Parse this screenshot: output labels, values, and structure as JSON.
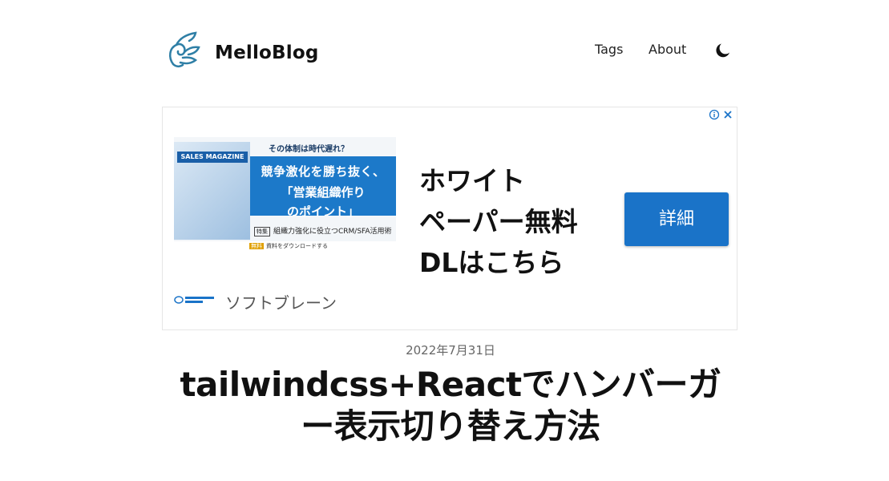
{
  "header": {
    "site_title": "MelloBlog",
    "nav": [
      {
        "label": "Tags"
      },
      {
        "label": "About"
      }
    ],
    "logo_icon": "wing-icon",
    "theme_toggle_icon": "moon-icon",
    "logo_color": "#2f7fa6"
  },
  "ad": {
    "info_icon": "info-icon",
    "close_icon": "close-icon",
    "image": {
      "magazine_title": "SALES MAGAZINE",
      "top_text": "その体制は時代遅れ？",
      "line1": "競争激化を勝ち抜く、",
      "line2": "「営業組織作り",
      "line3": "のポイント」",
      "bottom_tag": "特集",
      "bottom_text": "組織力強化に役立つCRM/SFA活用術",
      "download_tag": "無料",
      "download_text": "資料をダウンロードする"
    },
    "headline": "ホワイト\nペーパー無料\nDLはこちら",
    "cta_label": "詳細",
    "advertiser": "ソフトブレーン",
    "cta_color": "#1a73c8"
  },
  "post": {
    "date": "2022年7月31日",
    "title": "tailwindcss+Reactでハンバーガー表示切り替え方法"
  }
}
